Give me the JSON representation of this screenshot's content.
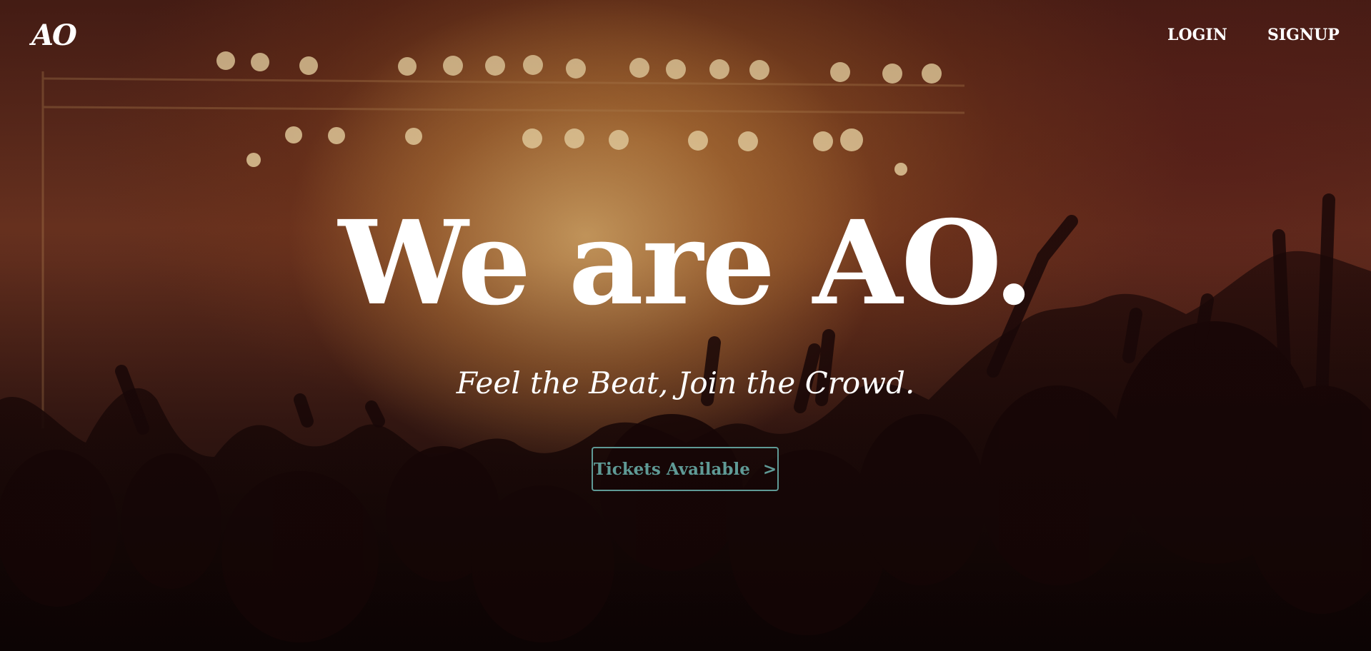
{
  "nav": {
    "logo": "AO",
    "login_label": "LOGIN",
    "signup_label": "SIGNUP"
  },
  "hero": {
    "title": "We are AO.",
    "tagline": "Feel the Beat, Join the Crowd.",
    "cta_label": "Tickets Available",
    "cta_arrow": ">"
  },
  "colors": {
    "text": "#ffffff",
    "cta_accent": "#5f9a96",
    "stage_glow": "#d6aa69",
    "background_dark": "#1a0b08"
  },
  "icons": {
    "cta_arrow": "chevron-right-icon"
  }
}
